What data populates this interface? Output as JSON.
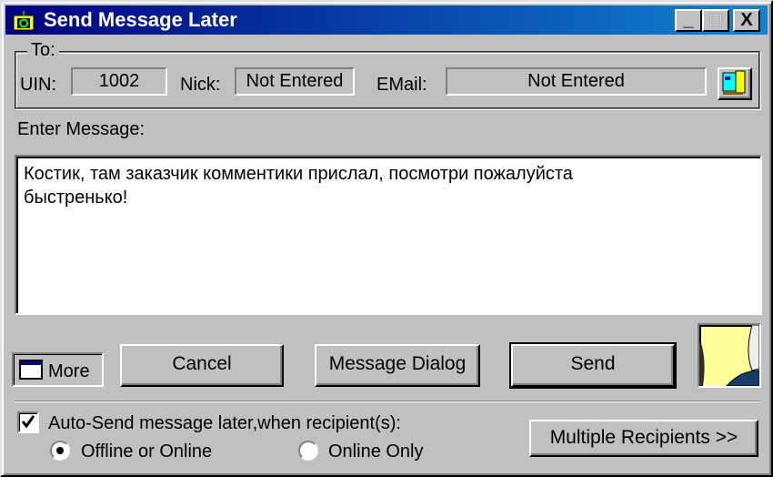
{
  "window": {
    "title": "Send Message Later",
    "controls": {
      "minimize": "_",
      "maximize": "□",
      "close": "X"
    }
  },
  "to": {
    "group_label": "To:",
    "uin_label": "UIN:",
    "uin_value": "1002",
    "nick_label": "Nick:",
    "nick_value": "Not Entered",
    "email_label": "EMail:",
    "email_value": "Not Entered",
    "contact_icon": "address-book-icon"
  },
  "message": {
    "label": "Enter Message:",
    "text": "Костик, там заказчик комментики прислал, посмотри пожалуйста\nбыстренько!"
  },
  "buttons": {
    "more": "More",
    "cancel": "Cancel",
    "message_dialog": "Message Dialog",
    "send": "Send",
    "multiple_recipients": "Multiple Recipients >>"
  },
  "options": {
    "auto_send_label": "Auto-Send message later,when recipient(s):",
    "auto_send_checked": true,
    "radio_offline_or_online": "Offline or Online",
    "radio_online_only": "Online Only",
    "selected": "Offline or Online"
  }
}
